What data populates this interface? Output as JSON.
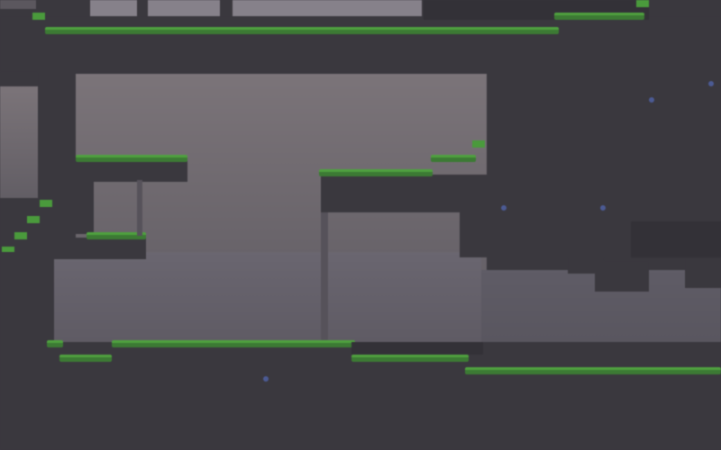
{
  "scene": {
    "name": "cave-platformer-level",
    "colors": {
      "rock": "#3a383e",
      "rock_dark": "#333137",
      "cave_light": "#7b7479",
      "grass": "#4fa03f",
      "sparkle": "#4a5a9a"
    },
    "sparkles": [
      "sparkle",
      "sparkle",
      "sparkle",
      "sparkle",
      "sparkle"
    ]
  }
}
